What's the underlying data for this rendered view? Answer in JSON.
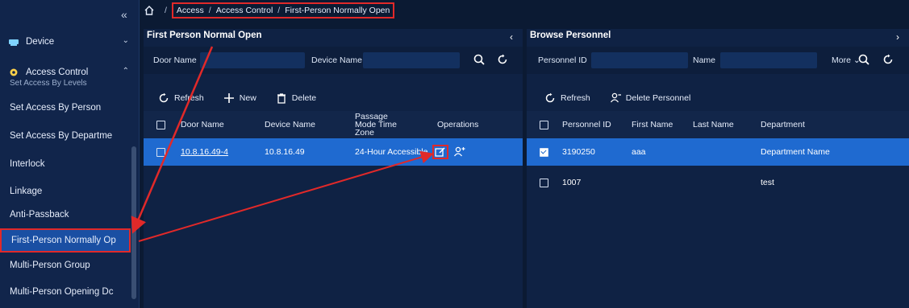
{
  "sidebar": {
    "groups": [
      {
        "label": "Device"
      },
      {
        "label": "Access Control"
      }
    ],
    "cut_item": "Set Access By Levels",
    "items": [
      {
        "label": "Set Access By Person"
      },
      {
        "label": "Set Access By Departme"
      },
      {
        "label": "Interlock"
      },
      {
        "label": "Linkage"
      },
      {
        "label": "Anti-Passback"
      },
      {
        "label": "First-Person Normally Op"
      },
      {
        "label": "Multi-Person Group"
      },
      {
        "label": "Multi-Person Opening Dc"
      }
    ]
  },
  "breadcrumb": {
    "items": [
      "Access",
      "Access Control",
      "First-Person Normally Open"
    ],
    "separator": "/"
  },
  "left_panel": {
    "title": "First Person Normal Open",
    "filters": {
      "door_name": "Door Name",
      "device_name": "Device Name"
    },
    "toolbar": {
      "refresh": "Refresh",
      "new": "New",
      "delete": "Delete"
    },
    "columns": [
      "Door Name",
      "Device Name",
      "Passage Mode Time Zone",
      "Operations"
    ],
    "rows": [
      {
        "door_name": "10.8.16.49-4",
        "device_name": "10.8.16.49",
        "time_zone": "24-Hour Accessible",
        "selected": true
      }
    ]
  },
  "right_panel": {
    "title": "Browse Personnel",
    "filters": {
      "personnel_id": "Personnel ID",
      "name": "Name",
      "more": "More"
    },
    "toolbar": {
      "refresh": "Refresh",
      "delete_personnel": "Delete Personnel"
    },
    "columns": [
      "Personnel ID",
      "First Name",
      "Last Name",
      "Department"
    ],
    "rows": [
      {
        "personnel_id": "3190250",
        "first_name": "aaa",
        "last_name": "",
        "department": "Department Name",
        "selected": true,
        "checked": true
      },
      {
        "personnel_id": "1007",
        "first_name": "",
        "last_name": "",
        "department": "test",
        "selected": false,
        "checked": false
      }
    ]
  },
  "colors": {
    "background": "#0b1a33",
    "panel": "#0f2244",
    "selected_row": "#1f6ad0",
    "highlight": "#e12929"
  }
}
